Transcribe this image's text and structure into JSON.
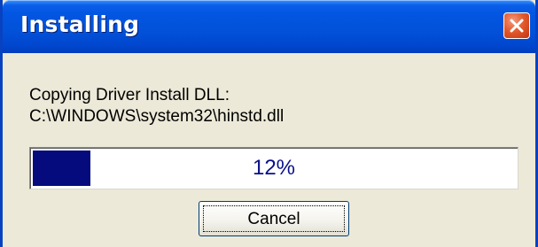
{
  "window": {
    "title": "Installing",
    "close_icon": "close-icon"
  },
  "message": {
    "line1": "Copying Driver Install DLL:",
    "line2": "C:\\WINDOWS\\system32\\hinstd.dll"
  },
  "progress": {
    "percent": 12,
    "label": "12%"
  },
  "buttons": {
    "cancel_label": "Cancel"
  },
  "colors": {
    "titlebar_blue": "#0356e2",
    "progress_fill": "#050a7d",
    "dialog_background": "#ece9d8",
    "close_red": "#e35a2e"
  }
}
